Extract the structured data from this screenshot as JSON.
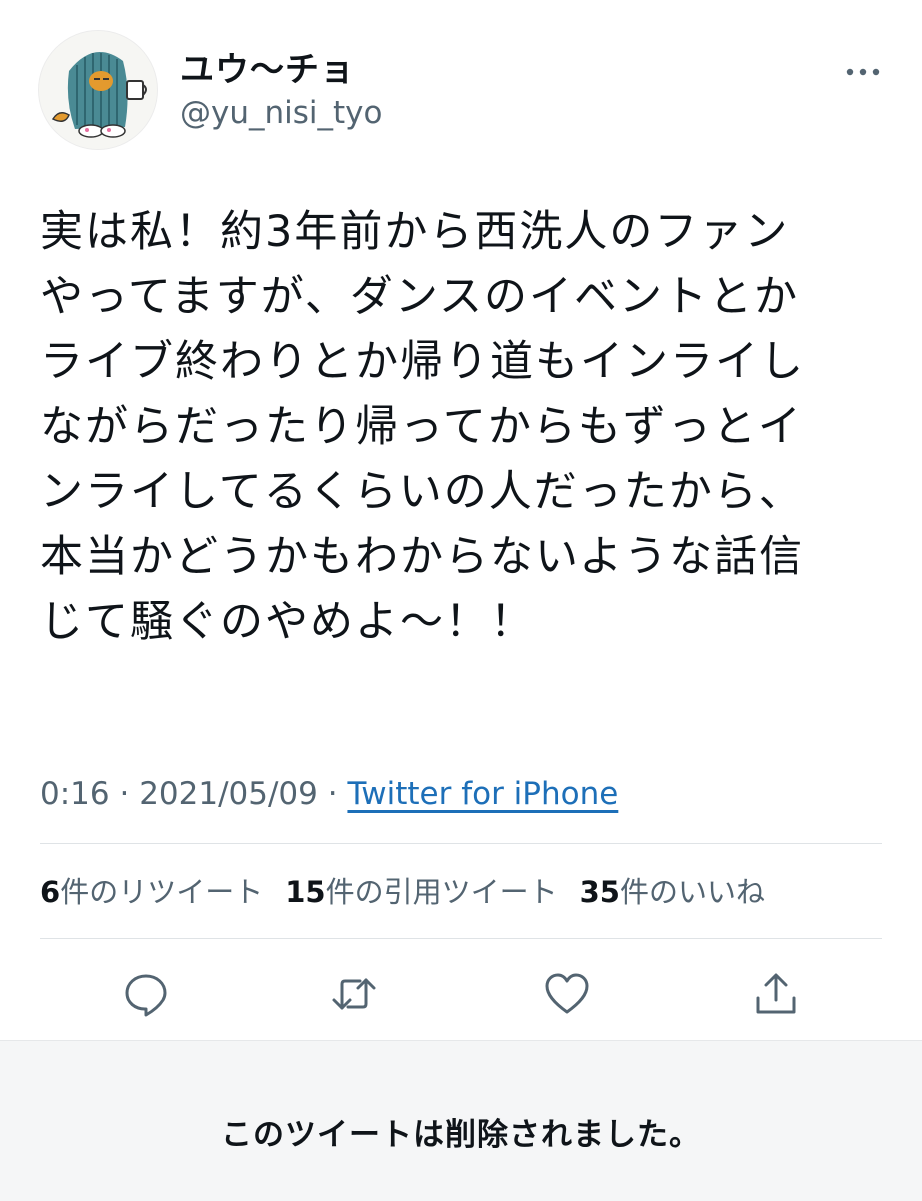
{
  "tweet": {
    "author": {
      "display_name": "ユウ〜チョ",
      "handle": "@yu_nisi_tyo"
    },
    "text": "実は私！約3年前から西洗人のファン\nやってますが、ダンスのイベントとか\nライブ終わりとか帰り道もインライし\nながらだったり帰ってからもずっとイ\nンライしてるくらいの人だったから、\n本当かどうかもわからないような話信\nじて騒ぐのやめよ〜！！",
    "time": "0:16",
    "separator": " · ",
    "date": "2021/05/09",
    "source": "Twitter for iPhone",
    "stats": {
      "retweets": {
        "count": "6",
        "label": "件のリツイート"
      },
      "quotes": {
        "count": "15",
        "label": "件の引用ツイート"
      },
      "likes": {
        "count": "35",
        "label": "件のいいね"
      }
    }
  },
  "icons": {
    "more": "more-horizontal-icon",
    "reply": "reply-bubble-icon",
    "retweet": "retweet-icon",
    "like": "heart-icon",
    "share": "share-upload-icon"
  },
  "colors": {
    "text": "#0f1419",
    "secondary": "#536471",
    "icon": "#536471",
    "link": "#1d6fb8",
    "avatar_hood": "#4a8a94",
    "avatar_cat": "#e39a2e"
  },
  "deleted_notice": "このツイートは削除されました。"
}
